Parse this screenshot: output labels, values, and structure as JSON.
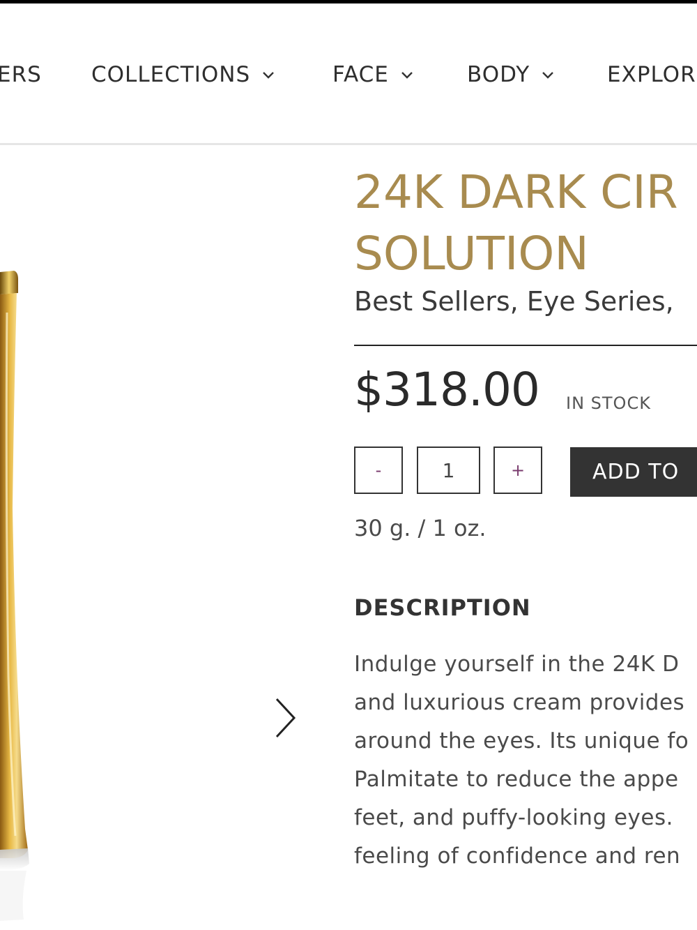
{
  "nav": {
    "items": [
      {
        "label": "ERS",
        "has_dropdown": false
      },
      {
        "label": "COLLECTIONS",
        "has_dropdown": true
      },
      {
        "label": "FACE",
        "has_dropdown": true
      },
      {
        "label": "BODY",
        "has_dropdown": true
      },
      {
        "label": "EXPLOR",
        "has_dropdown": false
      }
    ]
  },
  "product": {
    "title_line1": "24K DARK CIR",
    "title_line2": "SOLUTION",
    "categories": "Best Sellers, Eye Series,",
    "price": "$318.00",
    "stock_status": "IN STOCK",
    "quantity": {
      "decrement_label": "-",
      "value": "1",
      "increment_label": "+"
    },
    "add_to_cart_label": "ADD TO",
    "size": "30 g. / 1 oz.",
    "description_heading": "DESCRIPTION",
    "description_lines": [
      "Indulge yourself in the 24K D",
      "and luxurious cream provides",
      "around the eyes. Its unique fo",
      "Palmitate to reduce the appe",
      "feet, and puffy-looking eyes.",
      "feeling of confidence and ren"
    ]
  },
  "colors": {
    "title_gold": "#a88b4f",
    "button_dark": "#333333",
    "qty_symbol": "#7a3b6e"
  },
  "icons": {
    "dropdown": "chevron-down-icon",
    "gallery_next": "chevron-right-icon"
  }
}
